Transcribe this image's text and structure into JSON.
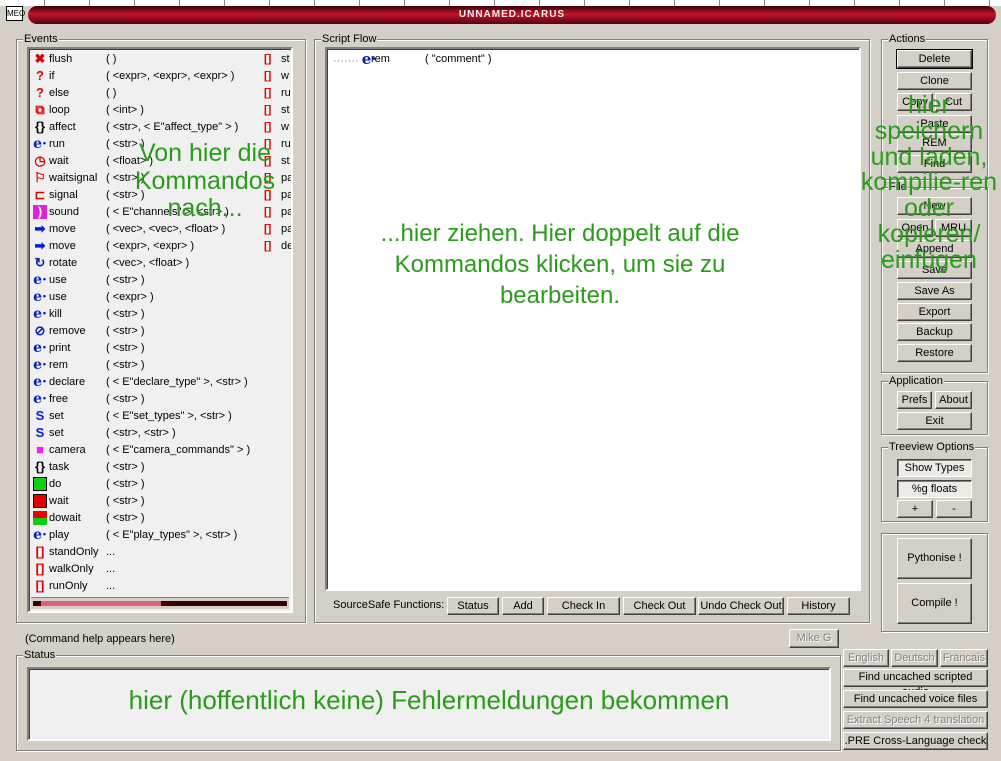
{
  "title": "UNNAMED.ICARUS",
  "app_icon": "MEO",
  "events": {
    "label": "Events",
    "items": [
      {
        "icon": "flush",
        "name": "flush",
        "args": "(    )",
        "col": "[]",
        "trail": "st"
      },
      {
        "icon": "question",
        "name": "if",
        "args": "( <expr>, <expr>, <expr>  )",
        "col": "[]",
        "trail": "w"
      },
      {
        "icon": "question",
        "name": "else",
        "args": "(    )",
        "col": "[]",
        "trail": "ru"
      },
      {
        "icon": "loop",
        "name": "loop",
        "args": "( <int>  )",
        "col": "[]",
        "trail": "st"
      },
      {
        "icon": "braces",
        "name": "affect",
        "args": "( <str>, < E\"affect_type\" >  )",
        "col": "[]",
        "trail": "w"
      },
      {
        "icon": "e",
        "name": "run",
        "args": "( <str>  )",
        "col": "[]",
        "trail": "ru"
      },
      {
        "icon": "clock",
        "name": "wait",
        "args": "( <float>  )",
        "col": "[]",
        "trail": "st"
      },
      {
        "icon": "waitsignal",
        "name": "waitsignal",
        "args": "( <str>  )",
        "col": "[]",
        "trail": "pa"
      },
      {
        "icon": "signal",
        "name": "signal",
        "args": "( <str>  )",
        "col": "[]",
        "trail": "pa"
      },
      {
        "icon": "sound",
        "name": "sound",
        "args": "( < E\"channels\" >, <str>  )",
        "col": "[]",
        "trail": "pa"
      },
      {
        "icon": "arrow",
        "name": "move",
        "args": "( <vec>, <vec>, <float>  )",
        "col": "[]",
        "trail": "pa"
      },
      {
        "icon": "arrow",
        "name": "move",
        "args": "( <expr>, <expr>  )",
        "col": "[]",
        "trail": "de"
      },
      {
        "icon": "rotate",
        "name": "rotate",
        "args": "( <vec>, <float>  )"
      },
      {
        "icon": "e",
        "name": "use",
        "args": "( <str>  )"
      },
      {
        "icon": "e",
        "name": "use",
        "args": "( <expr>  )"
      },
      {
        "icon": "e",
        "name": "kill",
        "args": "( <str>  )"
      },
      {
        "icon": "remove",
        "name": "remove",
        "args": "( <str>  )"
      },
      {
        "icon": "e",
        "name": "print",
        "args": "( <str>  )"
      },
      {
        "icon": "e",
        "name": "rem",
        "args": "( <str>  )"
      },
      {
        "icon": "e",
        "name": "declare",
        "args": "( < E\"declare_type\" >, <str>  )"
      },
      {
        "icon": "e",
        "name": "free",
        "args": "( <str>  )"
      },
      {
        "icon": "s",
        "name": "set",
        "args": "( < E\"set_types\" >, <str>  )"
      },
      {
        "icon": "s",
        "name": "set",
        "args": "( <str>, <str>  )"
      },
      {
        "icon": "camera",
        "name": "camera",
        "args": "( < E\"camera_commands\" >  )"
      },
      {
        "icon": "braces",
        "name": "task",
        "args": "( <str>  )"
      },
      {
        "icon": "do",
        "name": "do",
        "args": "( <str>  )"
      },
      {
        "icon": "waitred",
        "name": "wait",
        "args": "( <str>  )"
      },
      {
        "icon": "dowait",
        "name": "dowait",
        "args": "( <str>  )"
      },
      {
        "icon": "e",
        "name": "play",
        "args": "( < E\"play_types\" >, <str>  )"
      },
      {
        "icon": "bracket",
        "name": "standOnly",
        "args": "..."
      },
      {
        "icon": "bracket",
        "name": "walkOnly",
        "args": "..."
      },
      {
        "icon": "bracket",
        "name": "runOnly",
        "args": "..."
      }
    ]
  },
  "script_flow": {
    "label": "Script Flow",
    "nodes": [
      {
        "icon": "e",
        "name": "rem",
        "args": "( \"comment\"  )"
      }
    ]
  },
  "sourcesafe": {
    "label": "SourceSafe Functions:",
    "buttons": [
      "Status",
      "Add",
      "Check In",
      "Check Out",
      "Undo Check Out",
      "History"
    ]
  },
  "actions": {
    "label": "Actions",
    "delete": "Delete",
    "clone": "Clone",
    "copy": "Copy",
    "cut": "Cut",
    "paste": "Paste",
    "rem": "REM",
    "find": "Find"
  },
  "file": {
    "label": "File",
    "new": "New",
    "open": "Open",
    "mru": "MRU",
    "append": "Append",
    "save": "Save",
    "save_as": "Save As",
    "export": "Export",
    "backup": "Backup",
    "restore": "Restore"
  },
  "application": {
    "label": "Application",
    "prefs": "Prefs",
    "about": "About",
    "exit": "Exit"
  },
  "treeview": {
    "label": "Treeview Options",
    "show_types": "Show Types",
    "floats": "%g floats",
    "plus": "+",
    "minus": "-"
  },
  "build": {
    "pythonise": "Pythonise !",
    "compile": "Compile !"
  },
  "command_help": "(Command help appears here)",
  "user_button": "Mike G",
  "status": {
    "label": "Status"
  },
  "languages": [
    "English",
    "Deutsch",
    "Francais"
  ],
  "tools": {
    "scripted_audio": "Find uncached scripted audio",
    "voice_files": "Find uncached voice files",
    "extract": "Extract Speech 4 translation",
    "pre_check": ".PRE Cross-Language check"
  },
  "annotations": {
    "events": "Von hier die Kommandos nach...",
    "script": "...hier ziehen. Hier doppelt auf die Kommandos klicken, um sie zu bearbeiten.",
    "right": "hier speichern und laden, kompilie-ren oder kopieren/ einfügen",
    "status": "hier (hoffentlich keine) Fehlermeldungen bekommen"
  },
  "colors": {
    "annotation": "#2a9b1a",
    "title_red": "#c0142a"
  }
}
